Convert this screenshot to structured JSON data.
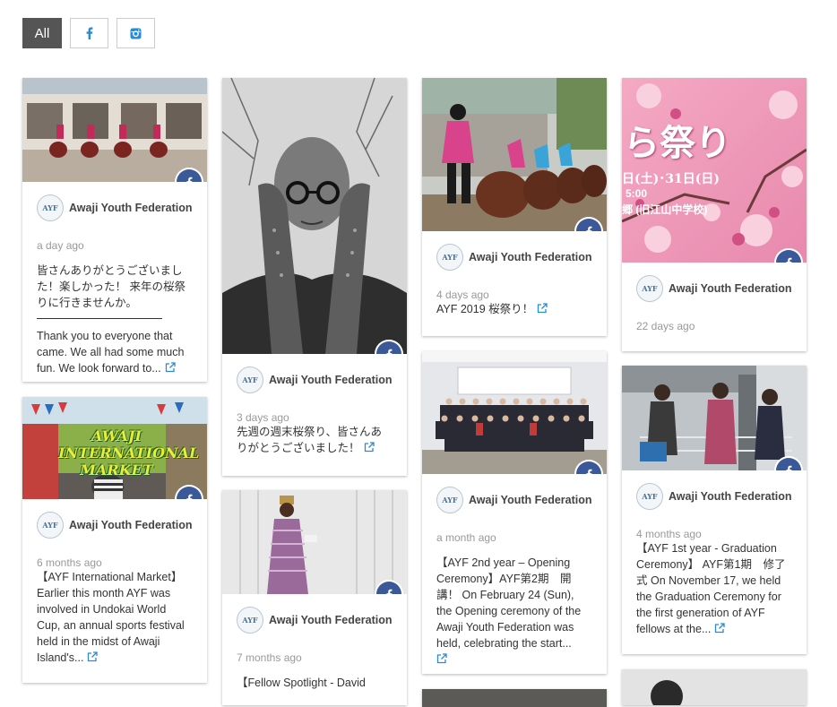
{
  "filters": [
    {
      "label": "All",
      "icon": null,
      "active": true
    },
    {
      "label": "",
      "icon": "facebook-icon",
      "active": false
    },
    {
      "label": "",
      "icon": "instagram-icon",
      "active": false
    }
  ],
  "author": {
    "name": "Awaji Youth Federation",
    "avatar_text": "AYF"
  },
  "colors": {
    "facebook": "#3b5998",
    "link": "#2a8ad4",
    "active_filter": "#555555"
  },
  "posts": [
    {
      "time": "a day ago",
      "text_ja": "皆さんありがとうございました！楽しかった！ 来年の桜祭りに行きませんか。",
      "text_en": "Thank you to everyone that came. We all had some much fun. We look forward to..."
    },
    {
      "time": "6 months ago",
      "text": "【AYF International Market】 Earlier this month AYF was involved in Undokai World Cup, an annual sports festival held in the midst of Awaji Island's...",
      "photo_caption": "AWAJI INTERNATIONAL MARKET"
    },
    {
      "time": "3 days ago",
      "text": "先週の週末桜祭り、皆さんありがとうございました！"
    },
    {
      "time": "7 months ago",
      "text": "【Fellow Spotlight - David"
    },
    {
      "time": "4 days ago",
      "text": "AYF 2019 桜祭り！"
    },
    {
      "time": "a month ago",
      "text": "【AYF 2nd year – Opening Ceremony】AYF第2期　開講！ On February 24 (Sun), the Opening ceremony of the Awaji Youth Federation was held, celebrating the start..."
    },
    {
      "time": "22 days ago",
      "photo_text_big": "ら祭り",
      "photo_text_small": "日(土)･31日(日)",
      "photo_text_time": "5:00",
      "photo_text_place": "郷 (旧江山中学校)"
    },
    {
      "time": "4 months ago",
      "text": "【AYF 1st year - Graduation Ceremony】 AYF第1期　修了式 On November 17, we held the Graduation Ceremony for the first generation of AYF fellows at the..."
    }
  ]
}
